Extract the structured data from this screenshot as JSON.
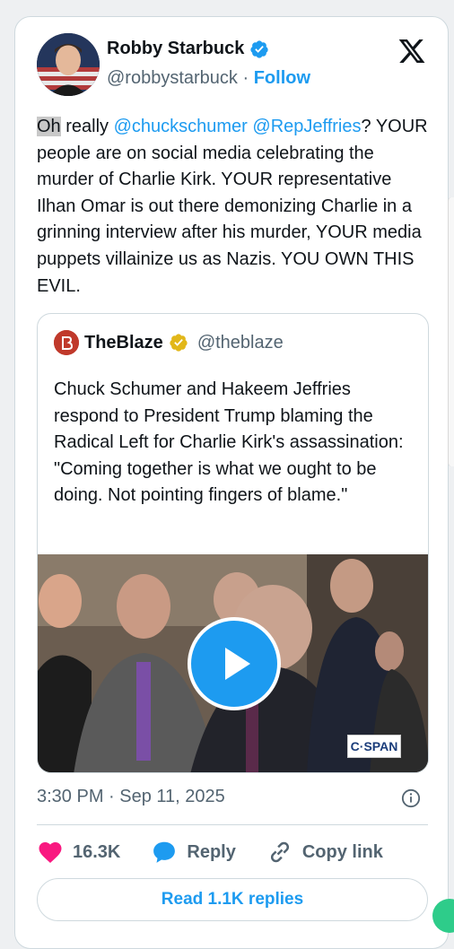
{
  "tweet": {
    "author_name": "Robby Starbuck",
    "author_handle": "@robbystarbuck",
    "separator": "·",
    "follow_label": "Follow",
    "text_part1": "Oh",
    "text_part2": " really ",
    "mention1": "@chuckschumer",
    "mention2": "@RepJeffries",
    "text_part3": "? YOUR people are on social media celebrating the murder of Charlie Kirk. YOUR representative Ilhan Omar is out there demonizing Charlie in a grinning interview after his murder, YOUR media puppets villainize us as Nazis. YOU OWN THIS EVIL.",
    "timestamp": "3:30 PM · Sep 11, 2025"
  },
  "quote": {
    "author_name": "TheBlaze",
    "author_handle": "@theblaze",
    "text": "Chuck Schumer and Hakeem Jeffries respond to President Trump blaming the Radical Left for Charlie Kirk's assassination: \"Coming together is what we ought to be doing. Not pointing fingers of blame.\"",
    "video_badge": "C·SPAN"
  },
  "actions": {
    "likes": "16.3K",
    "reply_label": "Reply",
    "copy_label": "Copy link",
    "read_replies": "Read 1.1K replies"
  },
  "icons": {
    "verified": "verified-badge-icon",
    "x_logo": "x-logo-icon",
    "heart": "heart-icon",
    "reply": "reply-bubble-icon",
    "link": "link-icon",
    "info": "info-icon",
    "play": "play-icon"
  },
  "colors": {
    "accent": "#1d9bf0",
    "like": "#f91880",
    "text": "#0f1419",
    "muted": "#536471",
    "gold_badge": "#e2b719"
  }
}
